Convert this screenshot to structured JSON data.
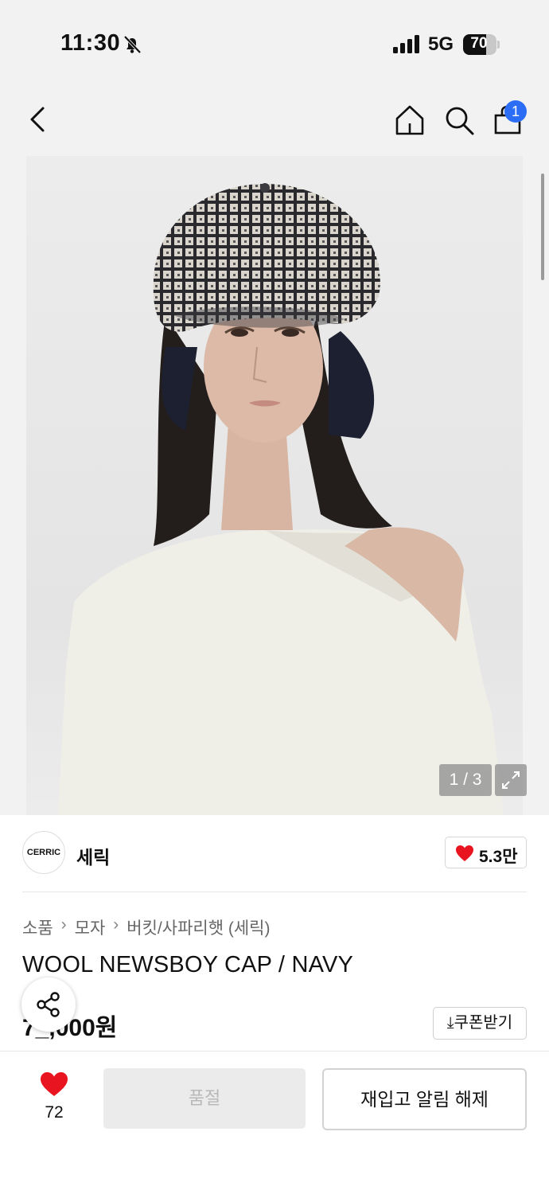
{
  "status_bar": {
    "time": "11:30",
    "network": "5G",
    "battery": "70",
    "battery_level": 0.7
  },
  "nav": {
    "cart_count": "1"
  },
  "gallery": {
    "counter": "1 / 3"
  },
  "brand": {
    "logo_text": "CERRIC",
    "name": "세릭",
    "likes": "5.3만"
  },
  "breadcrumb": [
    "소품",
    "모자",
    "버킷/사파리햇 (세릭)"
  ],
  "product": {
    "title": "WOOL NEWSBOY CAP / NAVY",
    "price": "7_,000원"
  },
  "coupon_label": "쿠폰받기",
  "bottom": {
    "wish_count": "72",
    "soldout_label": "품절",
    "restock_label": "재입고 알림 해제"
  },
  "colors": {
    "accent_badge": "#2b6ef5",
    "heart": "#e8141f"
  }
}
